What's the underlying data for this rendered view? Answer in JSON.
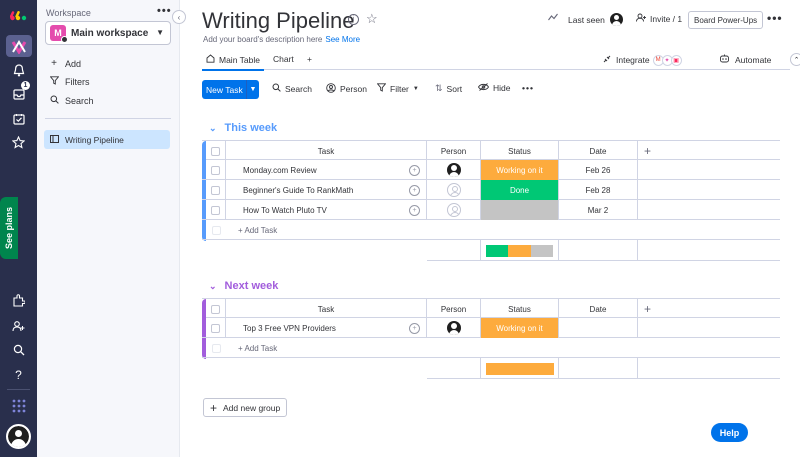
{
  "colors": {
    "blue": "#0073ea",
    "purple": "#a25ddc",
    "orange": "#fdab3d",
    "green": "#00c875",
    "gray": "#c4c4c4"
  },
  "rail": {
    "icons": [
      "monday-logo-icon",
      "bell-icon",
      "inbox-icon",
      "my-work-icon",
      "star-icon",
      "apps-icon",
      "invite-icon",
      "search-icon",
      "help-icon",
      "grid-icon"
    ],
    "inbox_badge": "1",
    "see_plans": "See plans"
  },
  "panel": {
    "workspace_label": "Workspace",
    "more": "•••",
    "workspace_letter": "M",
    "workspace_name": "Main workspace",
    "nav": [
      {
        "label": "Add",
        "icon": "plus-icon"
      },
      {
        "label": "Filters",
        "icon": "filter-icon"
      },
      {
        "label": "Search",
        "icon": "search-icon"
      }
    ],
    "board": "Writing Pipeline"
  },
  "header": {
    "title": "Writing Pipeline",
    "description": "Add your board's description here",
    "see_more": "See More",
    "last_seen": "Last seen",
    "invite": "Invite / 1",
    "power_ups": "Board Power-Ups",
    "more": "•••"
  },
  "tabs": {
    "main_table": "Main Table",
    "chart": "Chart",
    "add": "+",
    "integrate": "Integrate",
    "automate": "Automate"
  },
  "toolbar": {
    "new_task": "New Task",
    "search": "Search",
    "person": "Person",
    "filter": "Filter",
    "sort": "Sort",
    "hide": "Hide",
    "more": "•••"
  },
  "columns": {
    "task": "Task",
    "person": "Person",
    "status": "Status",
    "date": "Date",
    "add": "+"
  },
  "groups": [
    {
      "title": "This week",
      "color": "#579bfc",
      "rows": [
        {
          "task": "Monday.com Review",
          "person": "assigned",
          "status": "Working on it",
          "status_color": "#fdab3d",
          "date": "Feb 26"
        },
        {
          "task": "Beginner's Guide To RankMath",
          "person": "empty",
          "status": "Done",
          "status_color": "#00c875",
          "date": "Feb 28"
        },
        {
          "task": "How To Watch Pluto TV",
          "person": "empty",
          "status": "",
          "status_color": "#c4c4c4",
          "date": "Mar 2"
        }
      ],
      "add_task": "+ Add Task",
      "summary": [
        {
          "color": "#00c875",
          "fraction": 0.3333
        },
        {
          "color": "#fdab3d",
          "fraction": 0.3333
        },
        {
          "color": "#c4c4c4",
          "fraction": 0.3334
        }
      ]
    },
    {
      "title": "Next week",
      "color": "#a25ddc",
      "rows": [
        {
          "task": "Top 3 Free VPN Providers",
          "person": "assigned",
          "status": "Working on it",
          "status_color": "#fdab3d",
          "date": ""
        }
      ],
      "add_task": "+ Add Task",
      "summary": [
        {
          "color": "#fdab3d",
          "fraction": 1.0
        }
      ]
    }
  ],
  "add_group": "Add new group",
  "help": "Help"
}
